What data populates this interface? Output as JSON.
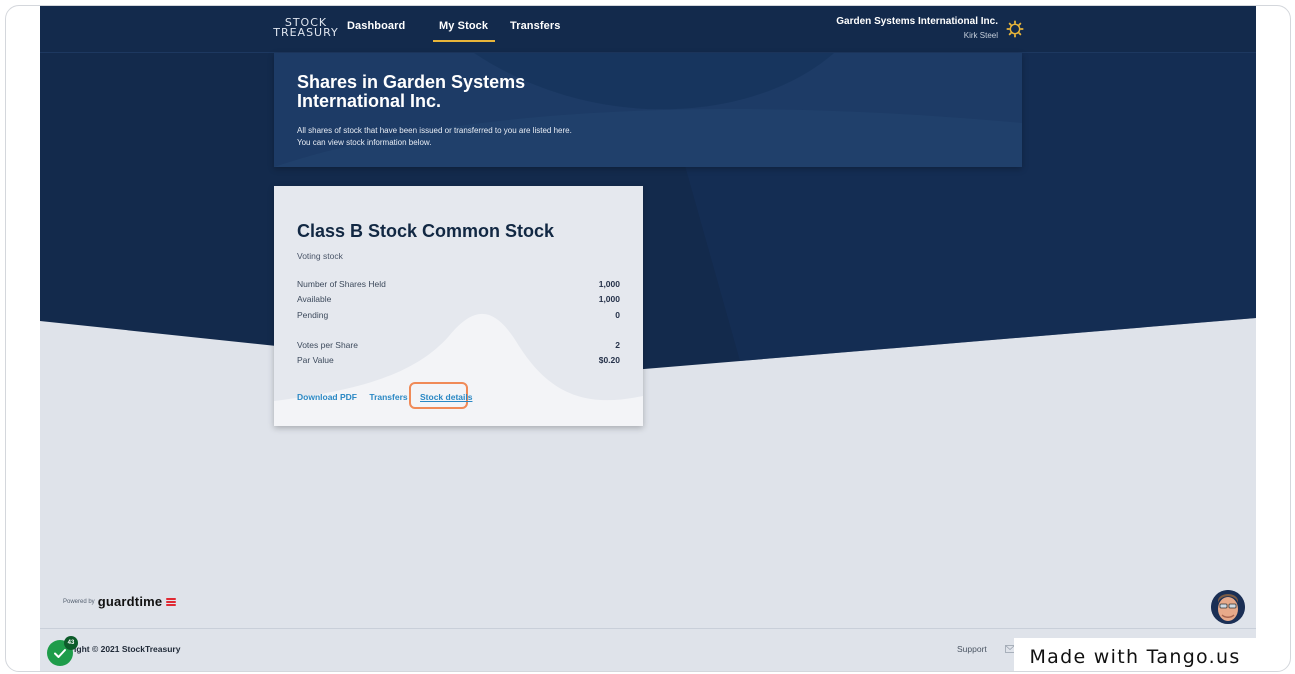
{
  "logo": {
    "line1": "STOCK",
    "line2": "TREASURY"
  },
  "nav": {
    "items": [
      {
        "label": "Dashboard"
      },
      {
        "label": "My Stock"
      },
      {
        "label": "Transfers"
      }
    ],
    "active": "My Stock"
  },
  "account": {
    "company": "Garden Systems International Inc.",
    "user": "Kirk Steel",
    "settings_icon": "gear-icon"
  },
  "banner": {
    "title": "Shares in Garden Systems International Inc.",
    "desc_line1": "All shares of stock that have been issued or transferred to you are listed here.",
    "desc_line2": "You can view stock information below."
  },
  "stock_card": {
    "title": "Class B Stock Common Stock",
    "subtitle": "Voting stock",
    "rows": [
      {
        "label": "Number of Shares Held",
        "value": "1,000"
      },
      {
        "label": "Available",
        "value": "1,000"
      },
      {
        "label": "Pending",
        "value": "0"
      },
      {
        "label": "Votes per Share",
        "value": "2"
      },
      {
        "label": "Par Value",
        "value": "$0.20"
      }
    ],
    "actions": {
      "download": "Download PDF",
      "transfers": "Transfers",
      "details": "Stock details"
    }
  },
  "footer": {
    "powered_by": "Powered by",
    "brand": "guardtime",
    "copyright": "yright © 2021 StockTreasury",
    "support": "Support"
  },
  "overlay": {
    "tango": "Made with Tango.us",
    "check_count": "43"
  },
  "colors": {
    "navy": "#132a4c",
    "accent_underline": "#e8b53a",
    "link": "#2a88c4",
    "highlight": "#f08a57"
  }
}
